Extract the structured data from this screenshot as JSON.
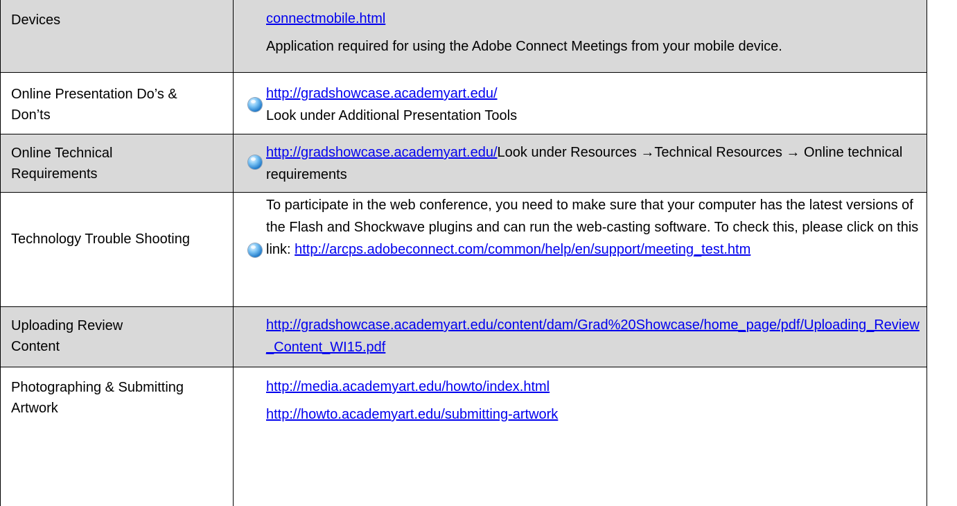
{
  "rows": [
    {
      "label": "Devices",
      "link": "connectmobile.html",
      "text": "Application required for using the Adobe Connect Meetings from your mobile device."
    },
    {
      "label": "Online Presentation Do’s & Don’ts",
      "link": "http://gradshowcase.academyart.edu/",
      "text": "Look under Additional Presentation Tools"
    },
    {
      "label": "Online Technical Requirements",
      "link": "http://gradshowcase.academyart.edu/",
      "text_a": "Look under Resources ",
      "arrow1": "→",
      "text_b": "Technical Resources ",
      "arrow2": "→",
      "text_c": " Online technical requirements"
    },
    {
      "label": "Technology Trouble Shooting",
      "text": "To participate in the web conference, you need to make sure that your computer has the latest versions of the Flash and Shockwave plugins and can run the web-casting software.  To check this, please click on this link: ",
      "link": "http://arcps.adobeconnect.com/common/help/en/support/meeting_test.htm"
    },
    {
      "label": "Uploading Review Content",
      "link": "http://gradshowcase.academyart.edu/content/dam/Grad%20Showcase/home_page/pdf/Uploading_Review_Content_WI15.pdf"
    },
    {
      "label": "Photographing & Submitting Artwork",
      "link1": "http://media.academyart.edu/howto/index.html",
      "link2": "http://howto.academyart.edu/submitting-artwork"
    }
  ]
}
